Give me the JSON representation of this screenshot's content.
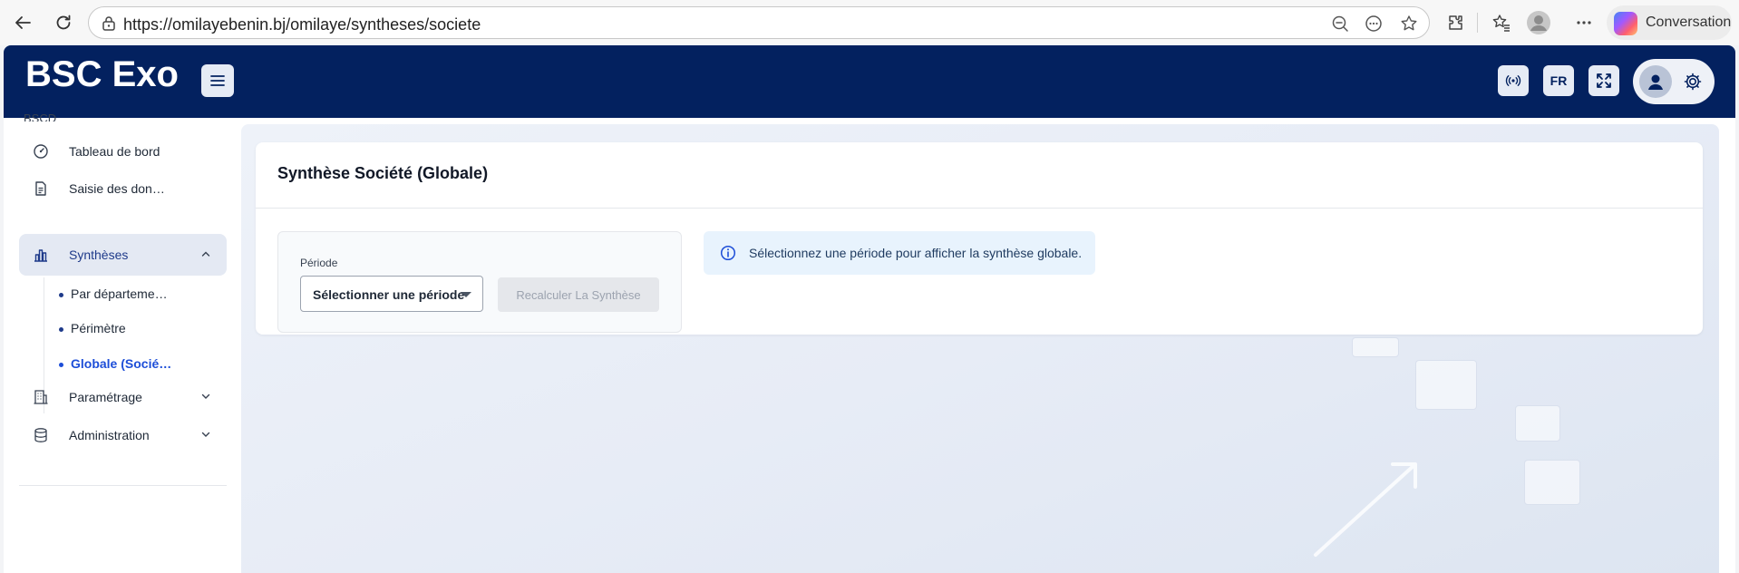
{
  "browser": {
    "url": "https://omilayebenin.bj/omilaye/syntheses/societe",
    "copilot_label": "Conversation"
  },
  "app": {
    "brand": "BSC Exo",
    "language_code": "FR",
    "accent_color": "#03215f"
  },
  "sidebar": {
    "section_cut_label": "BSCD",
    "items": [
      {
        "label": "Tableau de bord",
        "icon": "dashboard-gauge-icon"
      },
      {
        "label": "Saisie des don…",
        "icon": "document-icon"
      },
      {
        "label": "Synthèses",
        "icon": "bar-chart-icon",
        "expanded": true,
        "active": true
      },
      {
        "label": "Paramétrage",
        "icon": "building-icon",
        "expanded": false
      },
      {
        "label": "Administration",
        "icon": "database-icon",
        "expanded": false
      }
    ],
    "syntheses_children": [
      {
        "label": "Par départeme…"
      },
      {
        "label": "Périmètre"
      },
      {
        "label": "Globale (Socié…",
        "current": true
      }
    ]
  },
  "main": {
    "card_title": "Synthèse Société (Globale)",
    "period_label": "Période",
    "period_select_value": "Sélectionner une période",
    "recalc_button_label": "Recalculer La Synthèse",
    "info_message": "Sélectionnez une période pour afficher la synthèse globale."
  }
}
